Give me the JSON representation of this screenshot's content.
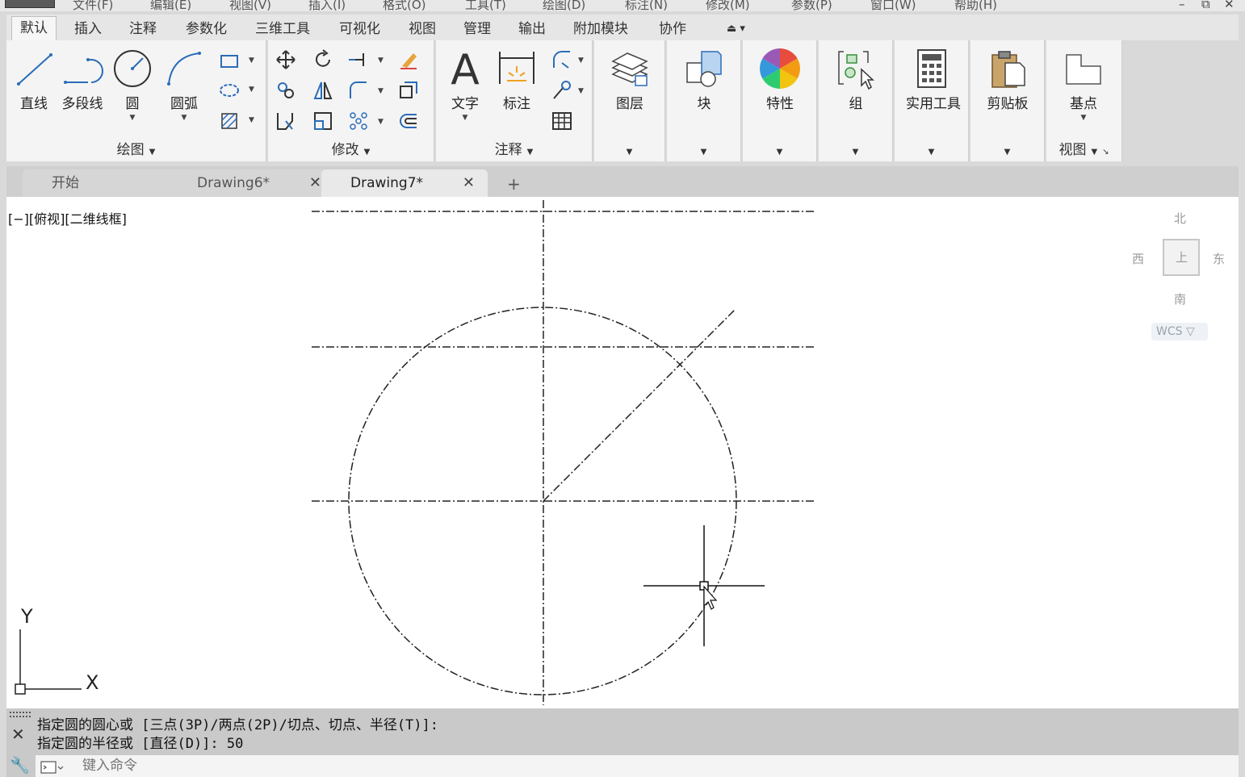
{
  "menu": {
    "items": [
      "文件(F)",
      "编辑(E)",
      "视图(V)",
      "插入(I)",
      "格式(O)",
      "工具(T)",
      "绘图(D)",
      "标注(N)",
      "修改(M)",
      "参数(P)",
      "窗口(W)",
      "帮助(H)"
    ]
  },
  "window": {
    "minimize": "–",
    "restore": "⧉",
    "close": "✕"
  },
  "ribbon_tabs": [
    "默认",
    "插入",
    "注释",
    "参数化",
    "三维工具",
    "可视化",
    "视图",
    "管理",
    "输出",
    "附加模块",
    "协作"
  ],
  "ribbon_tab_extra": "⏏ ▾",
  "ribbon": {
    "draw": {
      "title": "绘图",
      "line": "直线",
      "polyline": "多段线",
      "circle": "圆",
      "arc": "圆弧"
    },
    "modify": {
      "title": "修改"
    },
    "annotation": {
      "title": "注释",
      "text": "文字",
      "dimension": "标注"
    },
    "layers": {
      "label": "图层"
    },
    "block": {
      "label": "块"
    },
    "properties": {
      "label": "特性"
    },
    "groups": {
      "label": "组"
    },
    "utilities": {
      "label": "实用工具"
    },
    "clipboard": {
      "label": "剪贴板"
    },
    "view": {
      "label": "基点",
      "title": "视图"
    }
  },
  "doc_tabs": [
    {
      "label": "开始"
    },
    {
      "label": "Drawing6*"
    },
    {
      "label": "Drawing7*"
    }
  ],
  "doc_tab_close": "✕",
  "doc_tab_add": "+",
  "viewport": {
    "label": "[−][俯视][二维线框]"
  },
  "viewcube": {
    "north": "北",
    "south": "南",
    "east": "东",
    "west": "西",
    "face": "上",
    "wcs": "WCS ▽"
  },
  "ucs": {
    "x": "X",
    "y": "Y"
  },
  "command": {
    "history": [
      "指定圆的圆心或 [三点(3P)/两点(2P)/切点、切点、半径(T)]:",
      "指定圆的半径或 [直径(D)]: 50"
    ],
    "placeholder": "键入命令",
    "close": "✕"
  },
  "colors": {
    "accent_blue": "#2b6cb8",
    "ribbon_bg": "#f4f4f4",
    "canvas_bg": "#ffffff"
  }
}
